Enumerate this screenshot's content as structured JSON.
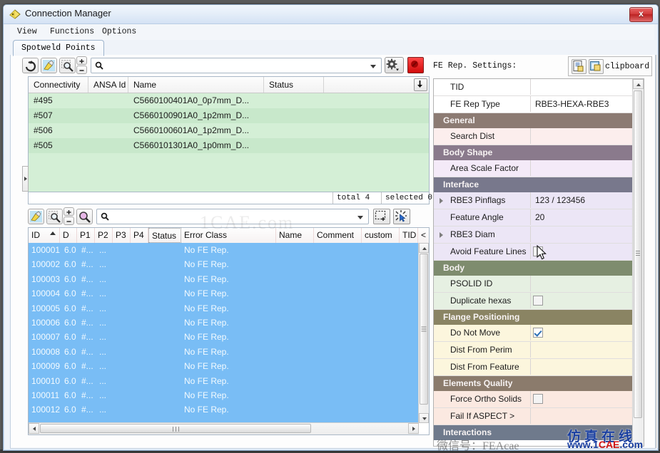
{
  "window": {
    "title": "Connection Manager",
    "title_icon": "diamond-tag-icon",
    "close_label": "x"
  },
  "menubar": {
    "items": [
      {
        "label": "View"
      },
      {
        "label": "Functions"
      },
      {
        "label": "Options"
      }
    ]
  },
  "tabs": [
    {
      "label": "Spotweld Points",
      "active": true
    }
  ],
  "top_toolbar": {
    "buttons": [
      {
        "name": "reload-button",
        "icon": "reload-icon"
      },
      {
        "name": "paint-button",
        "icon": "paint-brush-icon"
      },
      {
        "name": "zoom-button",
        "icon": "magnifier-icon"
      },
      {
        "name": "zoom-in-button",
        "icon": "plus-icon"
      },
      {
        "name": "zoom-out-button",
        "icon": "minus-icon"
      },
      {
        "name": "settings-button",
        "icon": "gear-icon"
      },
      {
        "name": "delete-button",
        "icon": "red-stop-icon"
      }
    ],
    "search_value": "",
    "search_placeholder": ""
  },
  "top_grid": {
    "columns": [
      "Connectivity",
      "ANSA Id",
      "Name",
      "Status",
      ""
    ],
    "rows": [
      {
        "connectivity": "#495",
        "ansa_id": "",
        "name": "C5660100401A0_0p7mm_D...",
        "status": "",
        "extra": ""
      },
      {
        "connectivity": "#507",
        "ansa_id": "",
        "name": "C5660100901A0_1p2mm_D...",
        "status": "",
        "extra": ""
      },
      {
        "connectivity": "#506",
        "ansa_id": "",
        "name": "C5660100601A0_1p2mm_D...",
        "status": "",
        "extra": ""
      },
      {
        "connectivity": "#505",
        "ansa_id": "",
        "name": "C5660101301A0_1p0mm_D...",
        "status": "",
        "extra": ""
      }
    ],
    "dropdown_icon": "down-arrow-icon"
  },
  "status_row": {
    "filter_value": "",
    "total_label": "total 4",
    "selected_label": "selected 0"
  },
  "bottom_toolbar": {
    "buttons": [
      {
        "name": "paint-button",
        "icon": "paint-brush-icon"
      },
      {
        "name": "zoom-button",
        "icon": "magnifier-icon"
      },
      {
        "name": "zoom-in-button",
        "icon": "plus-icon"
      },
      {
        "name": "zoom-out-button",
        "icon": "minus-icon"
      },
      {
        "name": "magnifier-pink-button",
        "icon": "magnifier-pink-icon"
      },
      {
        "name": "rect-select-button",
        "icon": "rect-select-icon"
      },
      {
        "name": "pick-select-button",
        "icon": "pick-select-icon"
      }
    ],
    "search_value": "",
    "search_placeholder": ""
  },
  "bottom_grid": {
    "columns": [
      "ID",
      "D",
      "P1",
      "P2",
      "P3",
      "P4",
      "Status",
      "Error Class",
      "Name",
      "Comment",
      "custom",
      "TID",
      "<"
    ],
    "sorted_column": "ID",
    "rows": [
      {
        "id": "100001",
        "d": "6.0",
        "p1": "#...",
        "p2": "...",
        "p3": "",
        "p4": "",
        "status": "",
        "error_class": "No FE Rep."
      },
      {
        "id": "100002",
        "d": "6.0",
        "p1": "#...",
        "p2": "...",
        "p3": "",
        "p4": "",
        "status": "",
        "error_class": "No FE Rep."
      },
      {
        "id": "100003",
        "d": "6.0",
        "p1": "#...",
        "p2": "...",
        "p3": "",
        "p4": "",
        "status": "",
        "error_class": "No FE Rep."
      },
      {
        "id": "100004",
        "d": "6.0",
        "p1": "#...",
        "p2": "...",
        "p3": "",
        "p4": "",
        "status": "",
        "error_class": "No FE Rep."
      },
      {
        "id": "100005",
        "d": "6.0",
        "p1": "#...",
        "p2": "...",
        "p3": "",
        "p4": "",
        "status": "",
        "error_class": "No FE Rep."
      },
      {
        "id": "100006",
        "d": "6.0",
        "p1": "#...",
        "p2": "...",
        "p3": "",
        "p4": "",
        "status": "",
        "error_class": "No FE Rep."
      },
      {
        "id": "100007",
        "d": "6.0",
        "p1": "#...",
        "p2": "...",
        "p3": "",
        "p4": "",
        "status": "",
        "error_class": "No FE Rep."
      },
      {
        "id": "100008",
        "d": "6.0",
        "p1": "#...",
        "p2": "...",
        "p3": "",
        "p4": "",
        "status": "",
        "error_class": "No FE Rep."
      },
      {
        "id": "100009",
        "d": "6.0",
        "p1": "#...",
        "p2": "...",
        "p3": "",
        "p4": "",
        "status": "",
        "error_class": "No FE Rep."
      },
      {
        "id": "100010",
        "d": "6.0",
        "p1": "#...",
        "p2": "...",
        "p3": "",
        "p4": "",
        "status": "",
        "error_class": "No FE Rep."
      },
      {
        "id": "100011",
        "d": "6.0",
        "p1": "#...",
        "p2": "...",
        "p3": "",
        "p4": "",
        "status": "",
        "error_class": "No FE Rep."
      },
      {
        "id": "100012",
        "d": "6.0",
        "p1": "#...",
        "p2": "...",
        "p3": "",
        "p4": "",
        "status": "",
        "error_class": "No FE Rep."
      }
    ]
  },
  "fe_panel": {
    "title": "FE Rep. Settings:",
    "clipboard_label": "clipboard",
    "copy_icon": "copy-to-clipboard-icon",
    "paste_icon": "paste-from-clipboard-icon",
    "rows": [
      {
        "type": "prop",
        "label": "TID",
        "value": "",
        "bg": "#ffffff",
        "expander": false,
        "checkbox": null
      },
      {
        "type": "prop",
        "label": "FE Rep Type",
        "value": "RBE3-HEXA-RBE3",
        "bg": "#ffffff",
        "expander": false,
        "checkbox": null
      },
      {
        "type": "section",
        "label": "General",
        "bg": "#8c7b73"
      },
      {
        "type": "prop",
        "label": "Search Dist",
        "value": "",
        "bg": "#fceeed",
        "expander": false,
        "checkbox": null
      },
      {
        "type": "section",
        "label": "Body Shape",
        "bg": "#8a7a8c"
      },
      {
        "type": "prop",
        "label": "Area Scale Factor",
        "value": "",
        "bg": "#f4eaf8",
        "expander": false,
        "checkbox": null
      },
      {
        "type": "section",
        "label": "Interface",
        "bg": "#78788c"
      },
      {
        "type": "prop",
        "label": "RBE3 Pinflags",
        "value": "123 / 123456",
        "bg": "#ece6f6",
        "expander": true,
        "checkbox": null
      },
      {
        "type": "prop",
        "label": "Feature Angle",
        "value": "20",
        "bg": "#ece6f6",
        "expander": false,
        "checkbox": null
      },
      {
        "type": "prop",
        "label": "RBE3 Diam",
        "value": "",
        "bg": "#ece6f6",
        "expander": true,
        "checkbox": null
      },
      {
        "type": "prop",
        "label": "Avoid Feature Lines",
        "value": "",
        "bg": "#ece6f6",
        "expander": false,
        "checkbox": "off"
      },
      {
        "type": "section",
        "label": "Body",
        "bg": "#7e8c6e"
      },
      {
        "type": "prop",
        "label": "PSOLID ID",
        "value": "",
        "bg": "#e6f0e2",
        "expander": false,
        "checkbox": null
      },
      {
        "type": "prop",
        "label": "Duplicate hexas",
        "value": "",
        "bg": "#e6f0e2",
        "expander": false,
        "checkbox": "off"
      },
      {
        "type": "section",
        "label": "Flange Positioning",
        "bg": "#8a8463"
      },
      {
        "type": "prop",
        "label": "Do Not Move",
        "value": "",
        "bg": "#fcf6dd",
        "expander": false,
        "checkbox": "on"
      },
      {
        "type": "prop",
        "label": "Dist From Perim",
        "value": "",
        "bg": "#fcf6dd",
        "expander": false,
        "checkbox": null
      },
      {
        "type": "prop",
        "label": "Dist From Feature",
        "value": "",
        "bg": "#fcf6dd",
        "expander": false,
        "checkbox": null
      },
      {
        "type": "section",
        "label": "Elements Quality",
        "bg": "#8b7b6c"
      },
      {
        "type": "prop",
        "label": "Force Ortho Solids",
        "value": "",
        "bg": "#fbe9e1",
        "expander": false,
        "checkbox": "off"
      },
      {
        "type": "prop",
        "label": "Fail If ASPECT >",
        "value": "",
        "bg": "#fbe9e1",
        "expander": false,
        "checkbox": null
      },
      {
        "type": "section",
        "label": "Interactions",
        "bg": "#6f7a8c"
      }
    ]
  },
  "watermarks": {
    "center": "1CAE.com",
    "cn_text": "仿真在线",
    "url_w": "www.1",
    "url_r": "CAE",
    "url_w2": ".com",
    "bottom_cn": "微信号：FEAcae"
  },
  "colors": {
    "grid_selection": "#79bdf5",
    "grid_green_odd": "#d4efd6",
    "grid_green_even": "#c8e8cb",
    "close_red": "#d23c3c",
    "title_blue": "#dbe7f6"
  }
}
